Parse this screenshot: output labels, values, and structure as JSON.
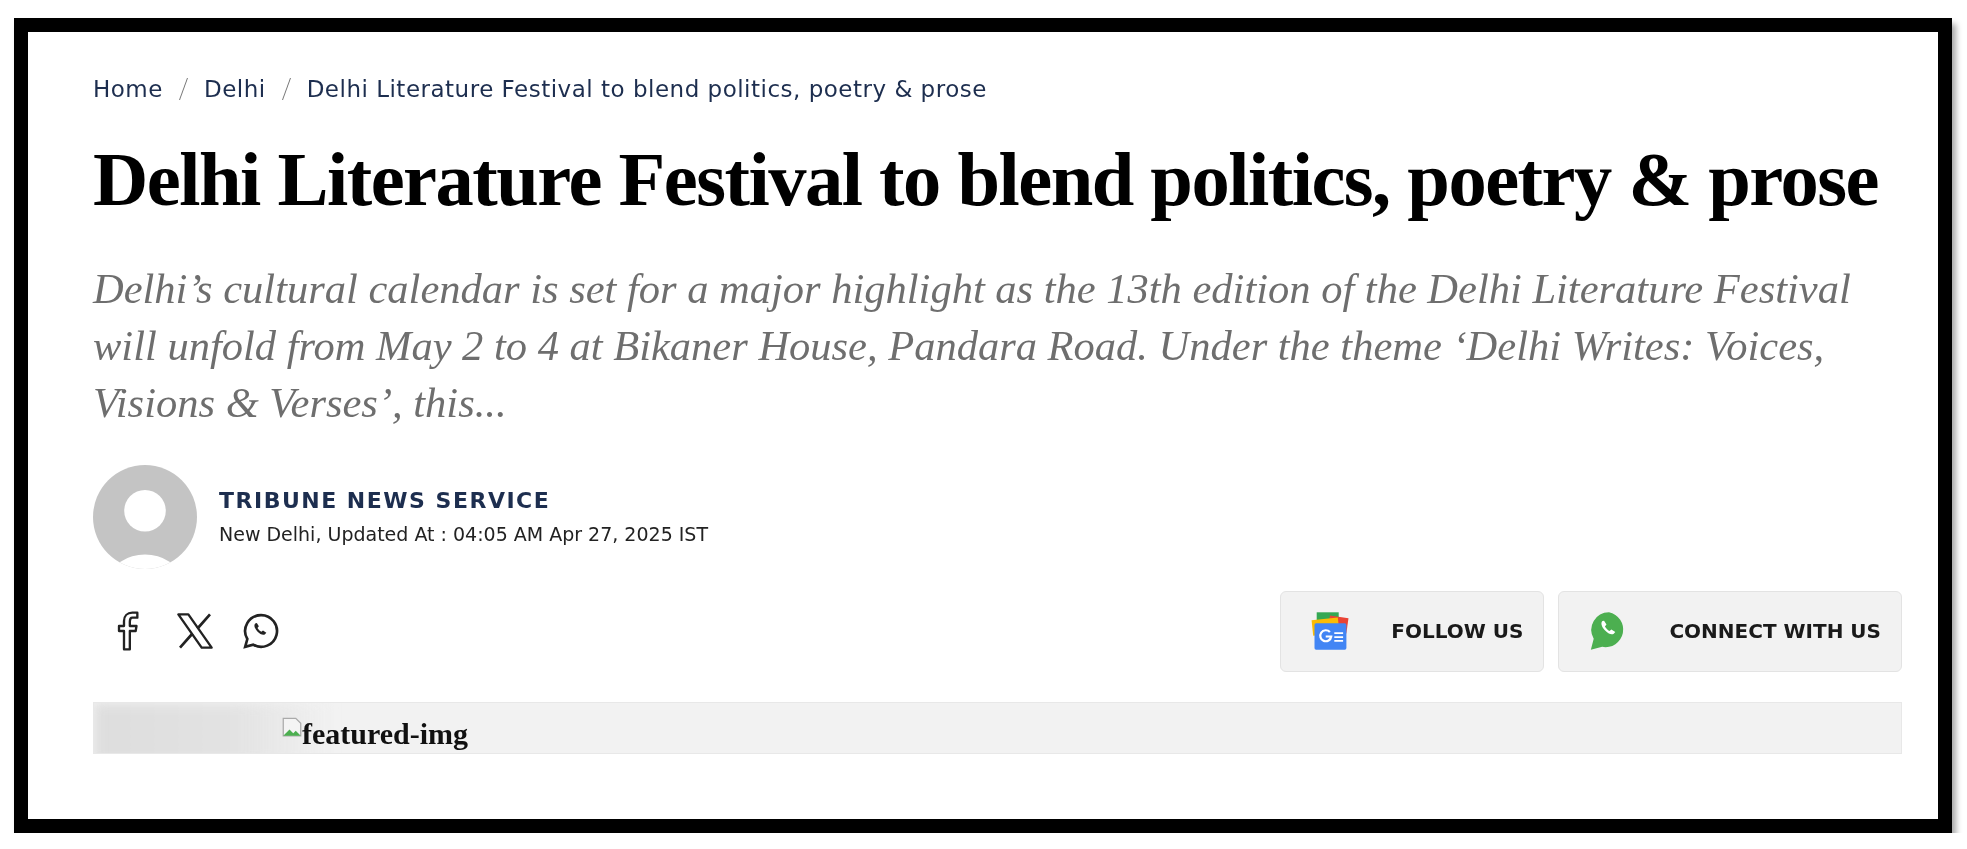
{
  "breadcrumb": [
    {
      "label": "Home"
    },
    {
      "label": "Delhi"
    },
    {
      "label": "Delhi Literature Festival to blend politics, poetry & prose"
    }
  ],
  "headline": "Delhi Literature Festival to blend politics, poetry & prose",
  "summary": "Delhi’s cultural calendar is set for a major highlight as the 13th edition of the Delhi Literature Festival will unfold from May 2 to 4 at Bikaner House, Pandara Road. Under the theme ‘Delhi Writes: Voices, Visions & Verses’, this...",
  "byline": {
    "author": "TRIBUNE NEWS SERVICE",
    "dateline": "New Delhi, Updated At : 04:05 AM Apr 27, 2025 IST"
  },
  "share": [
    {
      "kind": "facebook"
    },
    {
      "kind": "x"
    },
    {
      "kind": "whatsapp"
    }
  ],
  "actions": [
    {
      "kind": "news",
      "label": "FOLLOW US"
    },
    {
      "kind": "whatsapp",
      "label": "CONNECT WITH US"
    }
  ],
  "featured_image": {
    "alt_text": "featured-img"
  }
}
